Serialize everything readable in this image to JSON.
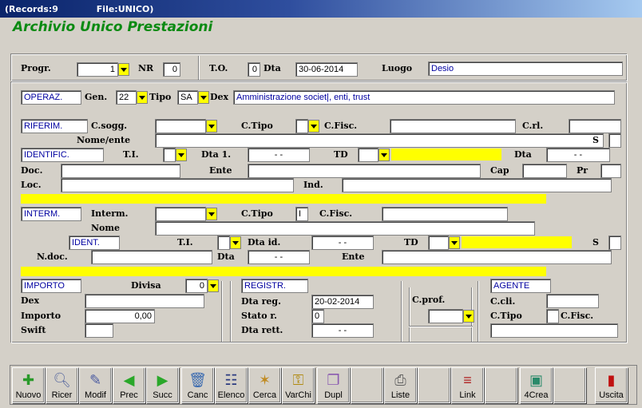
{
  "titlebar": {
    "records": "(Records:9",
    "file": "File:UNICO)"
  },
  "app_title": "Archivio Unico Prestazioni",
  "header": {
    "progr_label": "Progr.",
    "progr_value": "1",
    "nr_label": "NR",
    "nr_value": "0",
    "to_label": "T.O.",
    "to_value": "0",
    "dta_label": "Dta",
    "dta_value": "30-06-2014",
    "luogo_label": "Luogo",
    "luogo_value": "Desio"
  },
  "operaz": {
    "box": "OPERAZ.",
    "gen_label": "Gen.",
    "gen_value": "22",
    "tipo_label": "Tipo",
    "tipo_value": "SA",
    "dex_label": "Dex",
    "dex_value": "Amministrazione societ|, enti, trust"
  },
  "riferim": {
    "box": "RIFERIM.",
    "csogg_label": "C.sogg.",
    "ctipo_label": "C.Tipo",
    "cfisc_label": "C.Fisc.",
    "crl_label": "C.rl.",
    "nome_label": "Nome/ente",
    "s_label": "S"
  },
  "identific": {
    "box": "IDENTIFIC.",
    "ti_label": "T.I.",
    "dta1_label": "Dta 1.",
    "dta1_value": "-   -",
    "td_label": "TD",
    "dta_label": "Dta",
    "dta_value": "-   -",
    "doc_label": "Doc.",
    "ente_label": "Ente",
    "cap_label": "Cap",
    "pr_label": "Pr",
    "loc_label": "Loc.",
    "ind_label": "Ind."
  },
  "interm": {
    "box": "INTERM.",
    "interm_label": "Interm.",
    "ctipo_label": "C.Tipo",
    "ctipo_value": "I",
    "cfisc_label": "C.Fisc.",
    "nome_label": "Nome",
    "ident_box": "IDENT.",
    "ti_label": "T.I.",
    "dtaid_label": "Dta id.",
    "dtaid_value": "-   -",
    "td_label": "TD",
    "s_label": "S",
    "ndoc_label": "N.doc.",
    "dta_label": "Dta",
    "dta_value": "-   -",
    "ente_label": "Ente"
  },
  "importo": {
    "box": "IMPORTO",
    "divisa_label": "Divisa",
    "divisa_value": "0",
    "dex_label": "Dex",
    "importo_label": "Importo",
    "importo_value": "0,00",
    "swift_label": "Swift"
  },
  "registr": {
    "box": "REGISTR.",
    "dtareg_label": "Dta reg.",
    "dtareg_value": "20-02-2014",
    "stato_label": "Stato r.",
    "stato_value": "0",
    "dtarett_label": "Dta rett.",
    "dtarett_value": "-   -"
  },
  "cprof": {
    "label": "C.prof."
  },
  "agente": {
    "box": "AGENTE",
    "ccli_label": "C.cli.",
    "ctipo_label": "C.Tipo",
    "cfisc_label": "C.Fisc."
  },
  "toolbar": [
    {
      "label": "Nuovo",
      "icon": "new-doc-icon"
    },
    {
      "label": "Ricer",
      "icon": "magnifier-icon"
    },
    {
      "label": "Modif",
      "icon": "edit-icon"
    },
    {
      "label": "Prec",
      "icon": "arrow-left-icon"
    },
    {
      "label": "Succ",
      "icon": "arrow-right-icon"
    },
    {
      "label": "Canc",
      "icon": "trash-icon"
    },
    {
      "label": "Elenco",
      "icon": "list-icon"
    },
    {
      "label": "Cerca",
      "icon": "broom-icon"
    },
    {
      "label": "VarChi",
      "icon": "keys-icon"
    },
    {
      "label": "Dupl",
      "icon": "duplicate-icon"
    },
    {
      "label": "",
      "icon": ""
    },
    {
      "label": "Liste",
      "icon": "printer-icon"
    },
    {
      "label": "",
      "icon": ""
    },
    {
      "label": "Link",
      "icon": "network-icon"
    },
    {
      "label": "",
      "icon": ""
    },
    {
      "label": "4Crea",
      "icon": "create-icon"
    },
    {
      "label": "",
      "icon": ""
    },
    {
      "label": "Uscita",
      "icon": "exit-door-icon"
    }
  ]
}
